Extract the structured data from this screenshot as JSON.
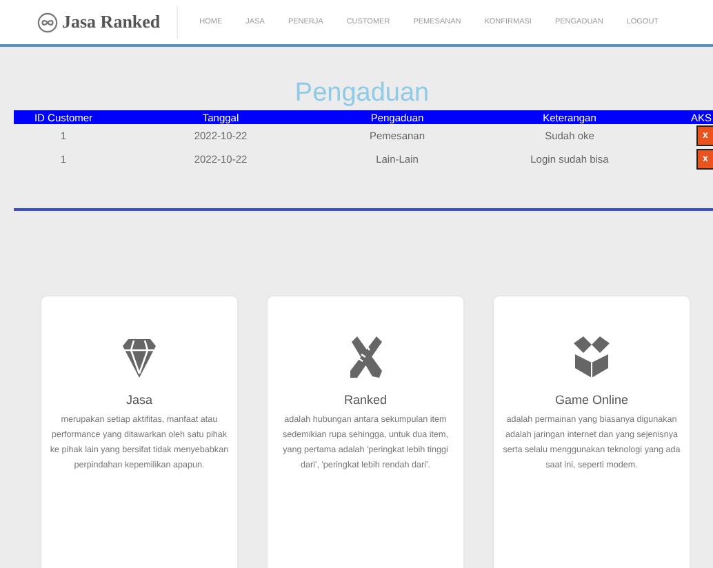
{
  "brand": {
    "name": "Jasa Ranked"
  },
  "nav": [
    {
      "label": "HOME"
    },
    {
      "label": "JASA"
    },
    {
      "label": "PENERJA"
    },
    {
      "label": "CUSTOMER"
    },
    {
      "label": "PEMESANAN"
    },
    {
      "label": "KONFIRMASI"
    },
    {
      "label": "PENGADUAN"
    },
    {
      "label": "LOGOUT"
    }
  ],
  "page_title": "Pengaduan",
  "table": {
    "columns": [
      "ID Customer",
      "Tanggal",
      "Pengaduan",
      "Keterangan",
      "AKS"
    ],
    "rows": [
      {
        "cells": [
          "1",
          "2022-10-22",
          "Pemesanan",
          "Sudah oke"
        ],
        "action": "x"
      },
      {
        "cells": [
          "1",
          "2022-10-22",
          "Lain-Lain",
          "Login sudah bisa"
        ],
        "action": "x"
      }
    ]
  },
  "cards": [
    {
      "title": "Jasa",
      "text": "merupakan setiap aktifitas, manfaat atau performance yang ditawarkan oleh satu pihak ke pihak lain yang bersifat tidak menyebabkan perpindahan kepemilikan apapun."
    },
    {
      "title": "Ranked",
      "text": "adalah hubungan antara sekumpulan item sedemikian rupa sehingga, untuk dua item, yang pertama adalah 'peringkat lebih tinggi dari', 'peringkat lebih rendah dari'."
    },
    {
      "title": "Game Online",
      "text": "adalah permainan yang biasanya digunakan adalah jaringan internet dan yang sejenisnya serta selalu menggunakan teknologi yang ada saat ini, seperti modem."
    }
  ]
}
